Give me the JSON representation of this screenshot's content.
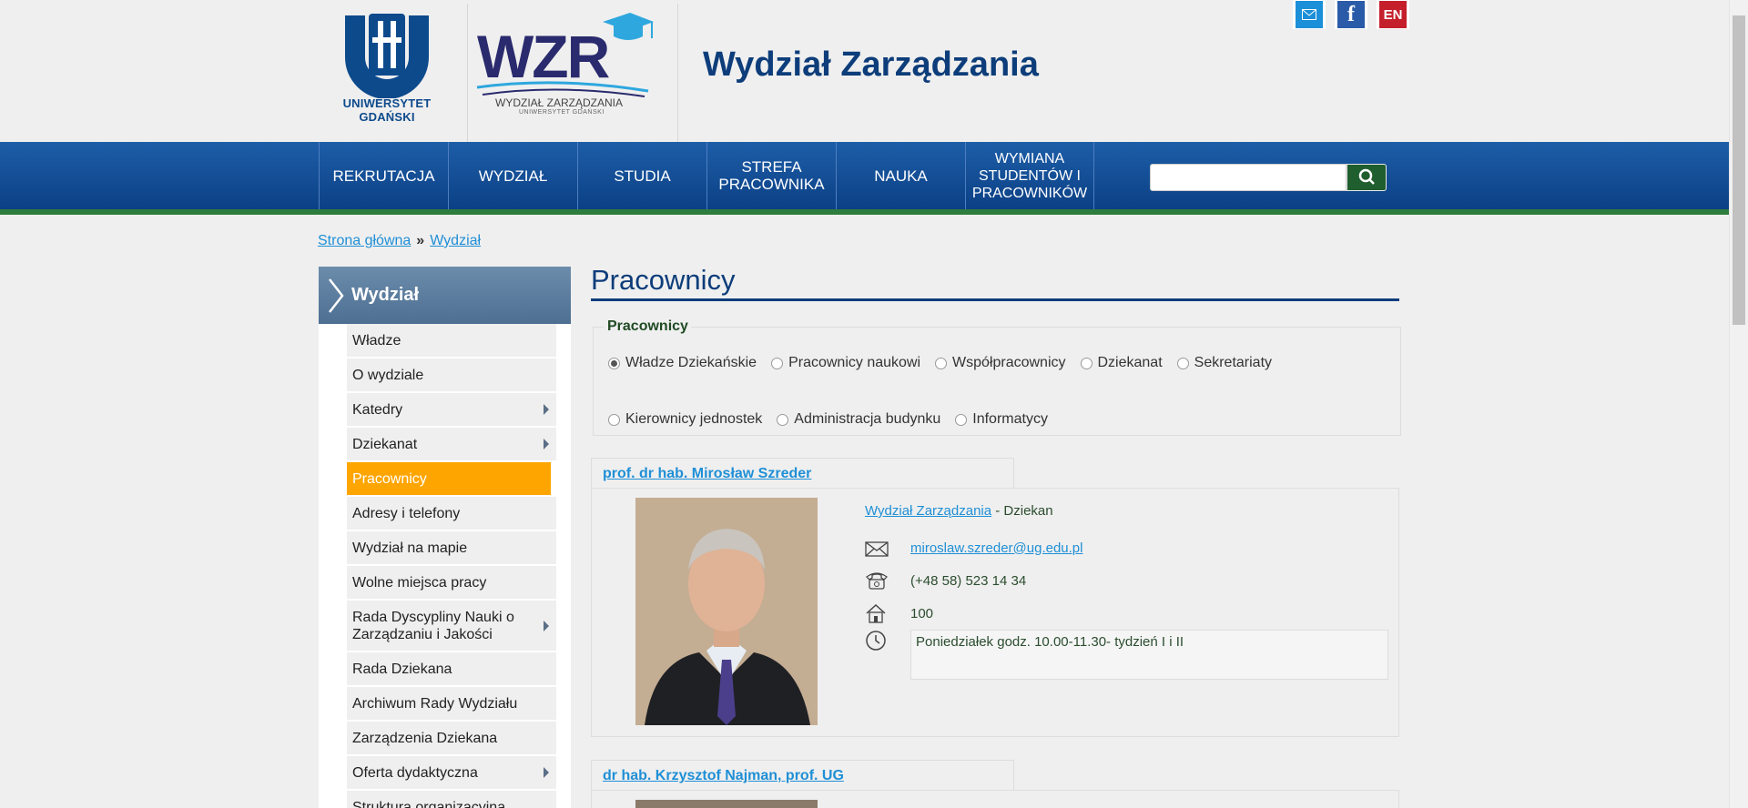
{
  "header": {
    "ug_label": "UNIWERSYTET GDAŃSKI",
    "wzr_logo": "WZR",
    "wzr_sub": "WYDZIAŁ ZARZĄDZANIA",
    "wzr_sub2": "UNIWERSYTET GDAŃSKI",
    "site_title": "Wydział Zarządzania",
    "lang_label": "EN",
    "fb_label": "f"
  },
  "nav": {
    "items": [
      "REKRUTACJA",
      "WYDZIAŁ",
      "STUDIA",
      "STREFA PRACOWNIKA",
      "NAUKA",
      "WYMIANA STUDENTÓW I PRACOWNIKÓW"
    ],
    "search_placeholder": ""
  },
  "breadcrumb": {
    "home": "Strona główna",
    "sep": "»",
    "current": "Wydział"
  },
  "sidebar": {
    "title": "Wydział",
    "items": [
      {
        "label": "Władze"
      },
      {
        "label": "O wydziale"
      },
      {
        "label": "Katedry"
      },
      {
        "label": "Dziekanat"
      },
      {
        "label": "Pracownicy"
      },
      {
        "label": "Adresy i telefony"
      },
      {
        "label": "Wydział na mapie"
      },
      {
        "label": "Wolne miejsca pracy"
      },
      {
        "label": "Rada Dyscypliny Nauki o Zarządzaniu i Jakości"
      },
      {
        "label": "Rada Dziekana"
      },
      {
        "label": "Archiwum Rady Wydziału"
      },
      {
        "label": "Zarządzenia Dziekana"
      },
      {
        "label": "Oferta dydaktyczna"
      },
      {
        "label": "Struktura organizacyjna"
      }
    ]
  },
  "main": {
    "page_title": "Pracownicy",
    "filter_legend": "Pracownicy",
    "radios": [
      {
        "label": "Władze Dziekańskie",
        "checked": true
      },
      {
        "label": "Pracownicy naukowi",
        "checked": false
      },
      {
        "label": "Współpracownicy",
        "checked": false
      },
      {
        "label": "Dziekanat",
        "checked": false
      },
      {
        "label": "Sekretariaty",
        "checked": false
      },
      {
        "label": "Kierownicy jednostek",
        "checked": false
      },
      {
        "label": "Administracja budynku",
        "checked": false
      },
      {
        "label": "Informatycy",
        "checked": false
      }
    ],
    "persons": [
      {
        "name": "prof. dr hab. Mirosław Szreder",
        "dept": "Wydział Zarządzania",
        "role": " - Dziekan",
        "email": "miroslaw.szreder@ug.edu.pl ",
        "phone": "(+48 58) 523 14 34",
        "room": "100",
        "hours": "Poniedziałek godz. 10.00-11.30- tydzień I i II"
      },
      {
        "name": "dr hab. Krzysztof Najman, prof. UG"
      }
    ]
  }
}
